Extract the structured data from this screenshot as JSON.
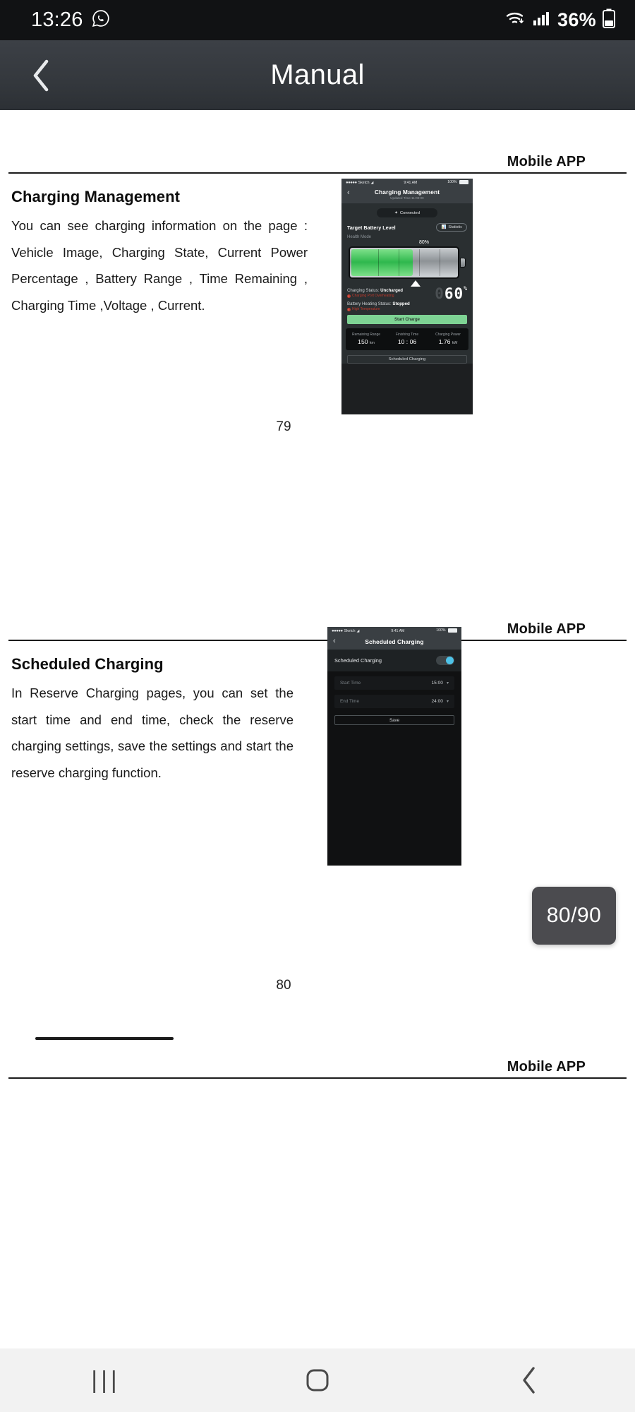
{
  "status_bar": {
    "time": "13:26",
    "whatsapp_icon": "whatsapp-icon",
    "wifi_icon": "wifi-icon",
    "signal_icon": "cellular-signal-icon",
    "battery_percent": "36%",
    "battery_icon": "battery-icon"
  },
  "app_bar": {
    "back_icon": "back-chevron-icon",
    "title": "Manual"
  },
  "document": {
    "pages": [
      {
        "header_title": "Mobile APP",
        "section_heading": "Charging Management",
        "paragraph": "You can see charging information on the page : Vehicle Image, Charging State, Current Power Percentage , Battery Range , Time Remaining , Charging Time ,Voltage , Current.",
        "page_number": "79",
        "figure": {
          "name": "charging-management-screenshot",
          "status_bar": {
            "carrier": "Sketch",
            "dots": "●●●●●",
            "wifi_icon": "wifi-icon",
            "time": "9:41 AM",
            "battery_percent": "100%"
          },
          "nav": {
            "back_icon": "back-chevron-icon",
            "title": "Charging Management",
            "subtitle": "Updated Time:11:00:00"
          },
          "connected_pill": {
            "bluetooth_icon": "bluetooth-icon",
            "label": "Connected"
          },
          "target_battery_level_label": "Target Battery Level",
          "statistic_button": {
            "chart_icon": "bar-chart-icon",
            "label": "Statistic"
          },
          "health_mode_label": "Health Mode",
          "target_percent_label": "80%",
          "battery_fill_percent": 57,
          "charging_status_label": "Charging Status:",
          "charging_status_value": "Uncharged",
          "charging_status_warning": "Charging Port Overheating",
          "heating_status_label": "Battery Heating Status:",
          "heating_status_value": "Stopped",
          "heating_status_warning": "High Temperature",
          "current_percent_ghost": "0",
          "current_percent": "60",
          "current_percent_unit": "%",
          "start_charge_button": "Start Charge",
          "stats": [
            {
              "label": "Remaining Range",
              "value": "150",
              "unit": "km"
            },
            {
              "label": "Finishing Time",
              "value": "10 : 06",
              "unit": ""
            },
            {
              "label": "Charging Power",
              "value": "1.76",
              "unit": "kW"
            }
          ],
          "scheduled_charging_button": "Scheduled Charging"
        }
      },
      {
        "header_title": "Mobile APP",
        "section_heading": "Scheduled Charging",
        "paragraph": "In Reserve Charging pages, you can set the start time and end time, check the reserve charging settings, save the settings and start the reserve charging function.",
        "page_number": "80",
        "figure": {
          "name": "scheduled-charging-screenshot",
          "status_bar": {
            "carrier": "Sketch",
            "dots": "●●●●●",
            "wifi_icon": "wifi-icon",
            "time": "9:41 AM",
            "battery_percent": "100%"
          },
          "nav": {
            "back_icon": "back-chevron-icon",
            "title": "Scheduled Charging"
          },
          "toggle_label": "Scheduled Charging",
          "toggle_state": "on",
          "toggle_color": "#4ec3e8",
          "fields": [
            {
              "label": "Start Time",
              "value": "15:00",
              "chevron": "chevron-down-icon"
            },
            {
              "label": "End Time",
              "value": "24:00",
              "chevron": "chevron-down-icon"
            }
          ],
          "save_button": "Save"
        }
      },
      {
        "header_title": "Mobile APP"
      }
    ]
  },
  "page_indicator": {
    "text": "80/90"
  },
  "bottom_nav": {
    "recents_icon": "recents-icon",
    "recents_label": "|||",
    "home_icon": "home-icon",
    "back_icon": "back-icon"
  },
  "colors": {
    "status_bar_bg": "#111214",
    "app_bar_bg": "#34383d",
    "accent_green": "#7ed394",
    "accent_cyan": "#4ec3e8",
    "warning_red": "#c0392b",
    "toast_bg": "#4b4b4f"
  }
}
